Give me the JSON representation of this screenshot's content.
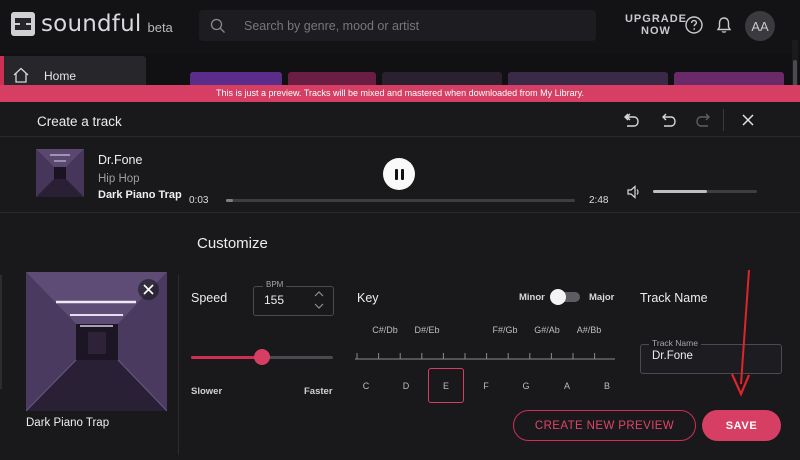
{
  "app": {
    "name": "soundful",
    "badge": "beta"
  },
  "search": {
    "placeholder": "Search by genre, mood or artist"
  },
  "header": {
    "upgrade_line1": "UPGRADE",
    "upgrade_line2": "NOW",
    "avatar_initials": "AA",
    "help_icon": "help-circle-icon",
    "bell_icon": "bell-icon"
  },
  "sidebar": {
    "items": [
      {
        "label": "Home",
        "icon": "home-icon"
      }
    ]
  },
  "modal": {
    "banner": "This is just a preview. Tracks will be mixed and mastered when downloaded from My Library.",
    "title": "Create a track",
    "icons": [
      "reset-icon",
      "undo-icon",
      "redo-icon",
      "close-icon"
    ]
  },
  "player": {
    "artist": "Dr.Fone",
    "genre": "Hip Hop",
    "track": "Dark Piano Trap",
    "time_current": "0:03",
    "time_total": "2:48",
    "progress": 0.02,
    "volume": 0.52
  },
  "customize": {
    "title": "Customize",
    "cover_name": "Dark Piano Trap",
    "speed": {
      "label": "Speed",
      "bpm_legend": "BPM",
      "bpm_value": "155",
      "slider_position": 0.5,
      "slower_label": "Slower",
      "faster_label": "Faster"
    },
    "key": {
      "label": "Key",
      "minor_label": "Minor",
      "major_label": "Major",
      "mode": "Major",
      "sharps": [
        "C#/Db",
        "D#/Eb",
        "F#/Gb",
        "G#/Ab",
        "A#/Bb"
      ],
      "naturals": [
        "C",
        "D",
        "E",
        "F",
        "G",
        "A",
        "B"
      ],
      "selected": "E"
    },
    "track_name": {
      "label": "Track Name",
      "legend": "Track Name",
      "value": "Dr.Fone"
    }
  },
  "buttons": {
    "create_preview": "CREATE NEW PREVIEW",
    "save": "SAVE"
  },
  "colors": {
    "accent": "#d63f63",
    "background": "#19191c",
    "annotation": "#e0242c"
  }
}
